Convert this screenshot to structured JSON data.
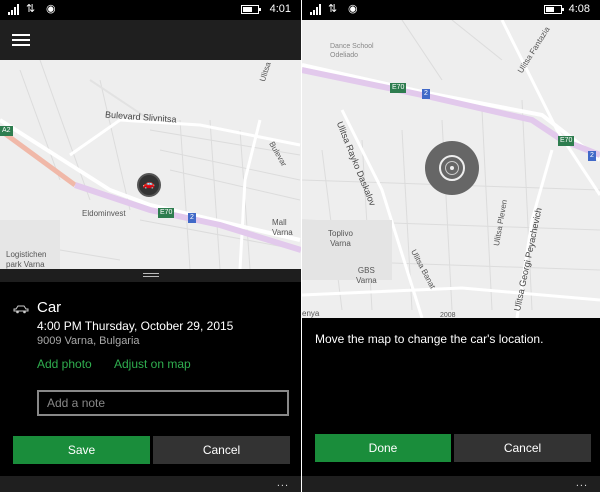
{
  "left": {
    "status_time": "4:01",
    "signal_glyph": "⇅",
    "nav_glyph": "◉",
    "battery_level": 0.65,
    "map": {
      "labels": {
        "bulevard_slivnitsa": "Bulevard  Slivnitsa",
        "ulitsa_vyara": "Ulitsa  Vyara",
        "bulevar": "Bulevar",
        "eldominvest": "Eldominvest",
        "mall_varna": "Mall\nVarna",
        "logistichen_park": "Logistichen\npark Varna"
      },
      "shields": {
        "a2": "A2",
        "e70": "E70",
        "two": "2"
      }
    },
    "sheet": {
      "icon": "car-icon",
      "title": "Car",
      "timeline": "4:00 PM Thursday, October 29, 2015",
      "address": "9009 Varna, Bulgaria",
      "add_photo": "Add photo",
      "adjust_on_map": "Adjust on map",
      "note_placeholder": "Add a note",
      "save_label": "Save",
      "cancel_label": "Cancel",
      "more_label": "..."
    }
  },
  "right": {
    "status_time": "4:08",
    "signal_glyph": "⇅",
    "nav_glyph": "◉",
    "battery_level": 0.55,
    "map": {
      "labels": {
        "dance_school": "Dance School\nOdeliado",
        "u_fantazia": "Ulitsa Fantazia",
        "ulitsa_rayko": "Ulitsa  Rayko  Daskalov",
        "ulitsa_pleven": "Ulitsa  Pleven",
        "ulitsa_georgi": "Ulitsa  Georgi  Peyachevich",
        "ulitsa_banat": "Ulitsa  Banat",
        "toplivo": "Toplivo\nVarna",
        "gbs": "GBS\nVarna",
        "bottom_left": "enya",
        "bottom_num": "2008"
      },
      "shields": {
        "e70a": "E70",
        "two_a": "2",
        "e70b": "E70",
        "two_b": "2"
      }
    },
    "instruction": "Move the map to change the car's location.",
    "done_label": "Done",
    "cancel_label": "Cancel",
    "more_label": "..."
  },
  "colors": {
    "accent_green": "#1a8d3b",
    "link_green": "#2fae4f",
    "highway": "#e2c9ec",
    "map_bg": "#eeeeee"
  }
}
